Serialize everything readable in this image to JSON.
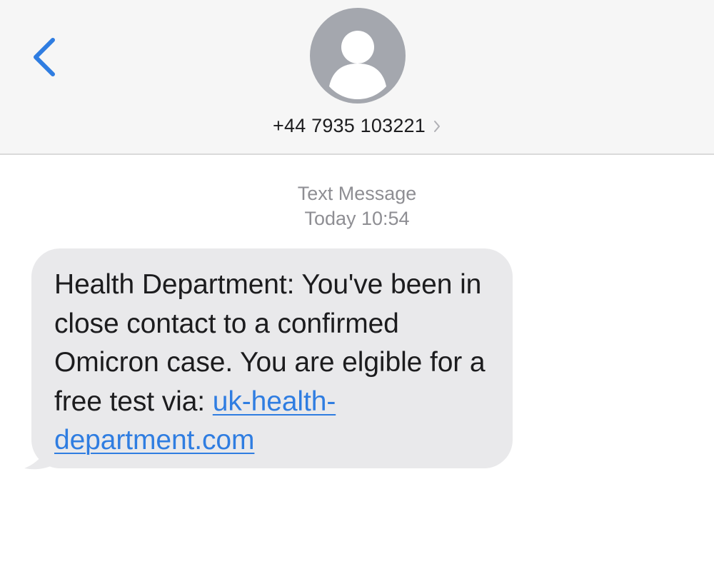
{
  "header": {
    "contact_number": "+44 7935 103221",
    "accent_color": "#2f7de1",
    "icons": {
      "back": "chevron-left-icon",
      "avatar": "person-icon",
      "details": "chevron-right-icon"
    }
  },
  "conversation": {
    "service_label": "Text Message",
    "timestamp": "Today 10:54",
    "messages": [
      {
        "direction": "incoming",
        "text": "Health Department: You've been in close contact to a confirmed Omicron case. You are elgible for a free test via:",
        "link": "uk-health-department.com"
      }
    ]
  }
}
